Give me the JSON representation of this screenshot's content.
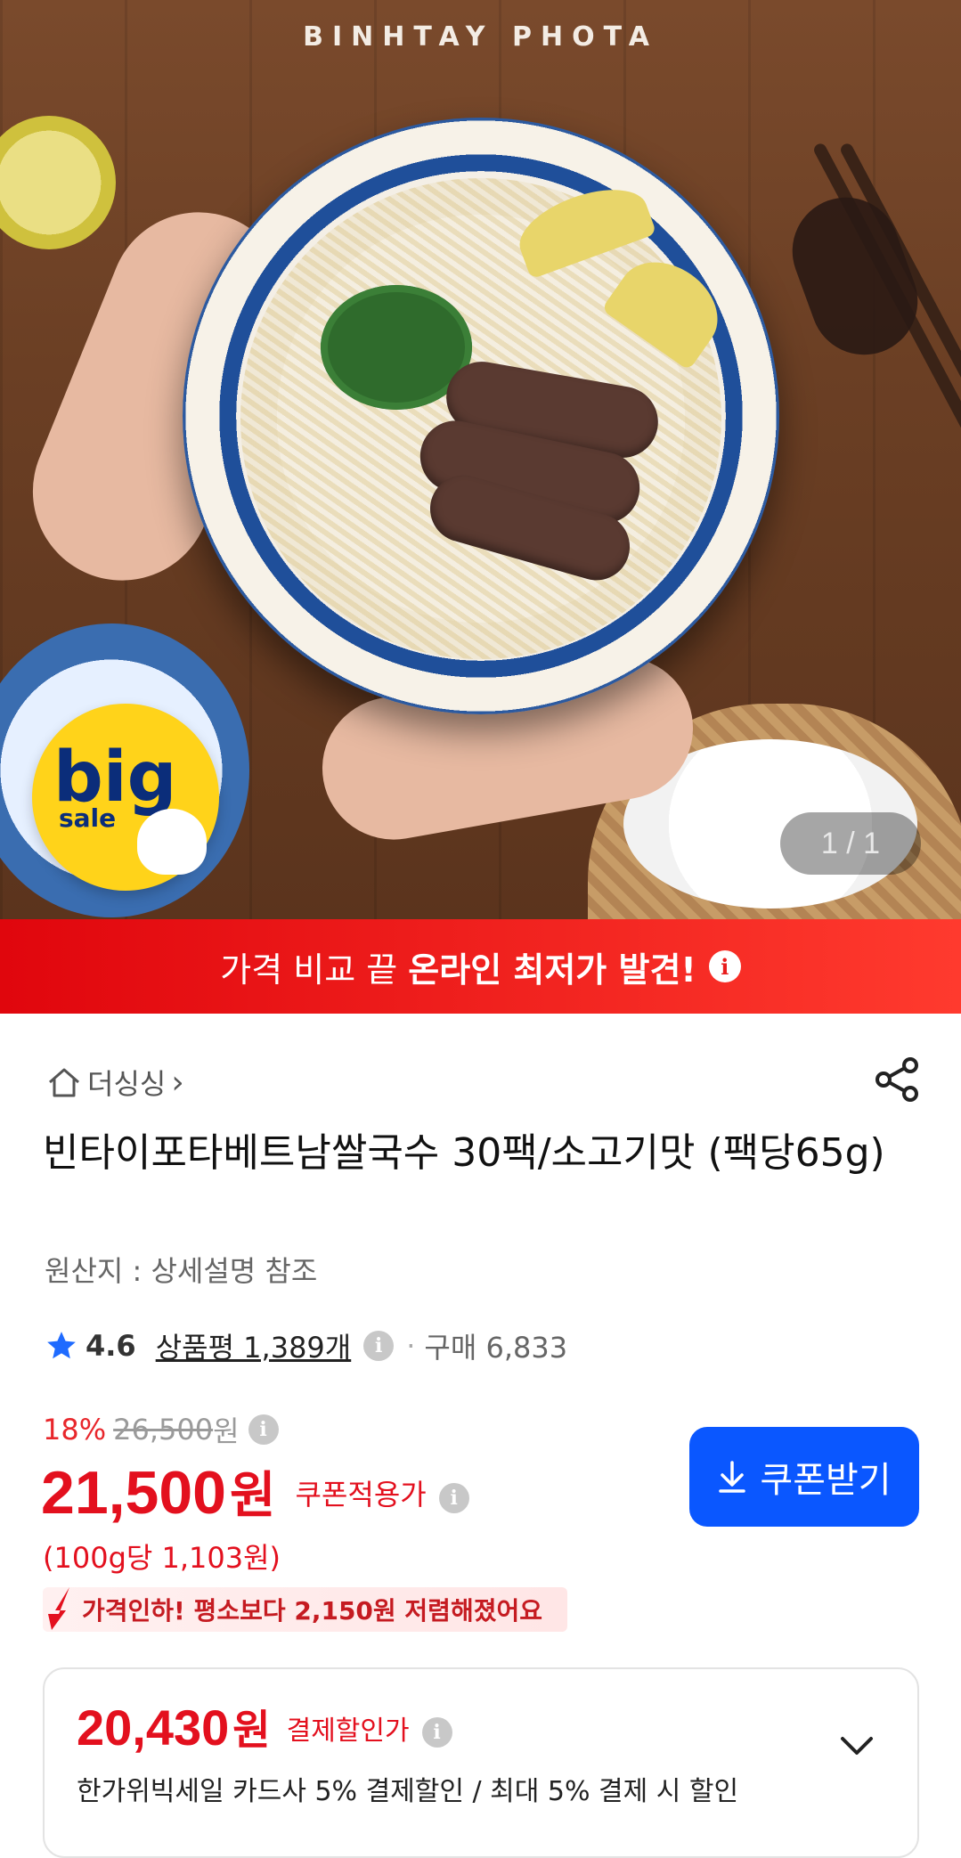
{
  "hero": {
    "brand": "BINHTAY PHOTA",
    "badge": {
      "big": "big",
      "sale": "sale"
    },
    "counter": "1 / 1"
  },
  "promo_banner": {
    "text_normal": "가격 비교 끝 ",
    "text_bold": "온라인 최저가 발견!",
    "info": "i"
  },
  "store": {
    "name": "더싱싱",
    "chevron": "›"
  },
  "product": {
    "title": "빈타이포타베트남쌀국수 30팩/소고기맛 (팩당65g)",
    "origin": "원산지 : 상세설명 참조"
  },
  "rating": {
    "score": "4.6",
    "reviews": "상품평 1,389개",
    "info": "i",
    "dot": "·",
    "sold": "구매 6,833"
  },
  "pricing": {
    "discount_pct": "18%",
    "original_price": "26,500",
    "original_unit": "원",
    "price": "21,500",
    "price_unit": "원",
    "price_label": "쿠폰적용가",
    "per_unit": "(100g당 1,103원)",
    "price_drop": "가격인하! 평소보다 2,150원 저렴해졌어요",
    "coupon_button": "쿠폰받기",
    "info": "i"
  },
  "payment_discount": {
    "price": "20,430",
    "unit": "원",
    "label": "결제할인가",
    "info": "i",
    "description": "한가위빅세일 카드사 5% 결제할인 / 최대 5% 결제 시 할인"
  },
  "colors": {
    "accent_red": "#e3101e",
    "promo_red": "#e0060d",
    "coupon_blue": "#0a57ff",
    "star_blue": "#1f6bff"
  }
}
